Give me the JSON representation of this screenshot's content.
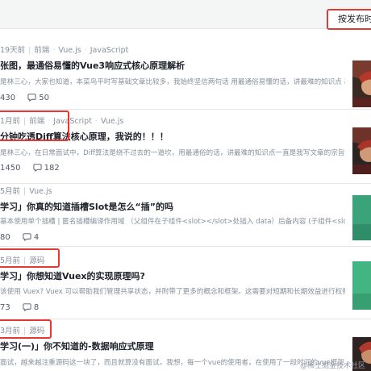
{
  "toolbar": {
    "sort_label": "按发布时间"
  },
  "articles": [
    {
      "date": "19天前",
      "tags": [
        "前端",
        "Vue.js",
        "JavaScript"
      ],
      "title": "张图，最通俗易懂的Vue3响应式核心原理解析",
      "desc": "是林三心，大家也知道，本菜鸟平时写基础文章比较多，我始终坚信两句话 用最通俗易懂的话，讲最难的知识点 基础",
      "likes": "430",
      "comments": "50"
    },
    {
      "date": "1月前",
      "tags": [
        "前端",
        "JavaScript",
        "Vue.js"
      ],
      "title": "分钟吃透Diff算法核心原理，我说的！！！",
      "desc": "是林三心，在日常面试中，Diff算法是绕不过去的一道坎，用最通俗的话，讲最难的知识点一直是我写文章的宗旨...",
      "likes": "1450",
      "comments": "182"
    },
    {
      "date": "5月前",
      "tags": [
        "Vue.js"
      ],
      "title": "学习」你真的知道插槽Slot是怎么“插”的吗",
      "desc": "基本使用单个插槽 | 匿名插槽编译作用域 （父组件在子组件<slot></slot>处插入 data）后备内容 (子组件<slot>",
      "likes": "80",
      "comments": "4"
    },
    {
      "date": "5月前",
      "tags": [
        "源码"
      ],
      "title": "学习」你想知道Vuex的实现原理吗?",
      "desc": "该使用 Vuex? Vuex 可以帮助我们管理共享状态，并附带了更多的概念和框架。这需要对短期和长期效益进行权衡。",
      "likes": "73",
      "comments": "8"
    },
    {
      "date": "3月前",
      "tags": [
        "源码"
      ],
      "title": "学习(一)」你不知道的-数据响应式原理",
      "desc": "面试，越来越注重源码这一块了，而且就算没有面试，我想，每一个vue的使用者，在使用了一段时间的vue框架之后",
      "likes": "",
      "comments": ""
    }
  ],
  "watermark": "@稀土掘金技术社区",
  "colors": {
    "highlight": "#e53935",
    "tag": "#86909c",
    "title": "#1d2129"
  }
}
